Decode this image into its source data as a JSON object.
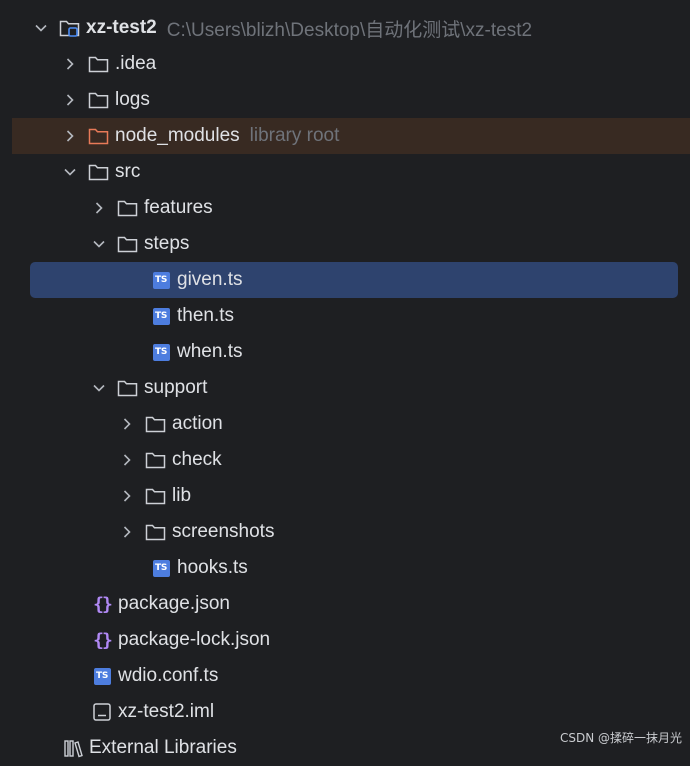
{
  "project": {
    "name": "xz-test2",
    "path": "C:\\Users\\blizh\\Desktop\\自动化测试\\xz-test2"
  },
  "tree": {
    "idea": ".idea",
    "logs": "logs",
    "node_modules": "node_modules",
    "node_modules_hint": "library root",
    "src": "src",
    "features": "features",
    "steps": "steps",
    "given": "given.ts",
    "then": "then.ts",
    "when": "when.ts",
    "support": "support",
    "action": "action",
    "check": "check",
    "lib": "lib",
    "screenshots": "screenshots",
    "hooks": "hooks.ts",
    "package_json": "package.json",
    "package_lock": "package-lock.json",
    "wdio_conf": "wdio.conf.ts",
    "iml": "xz-test2.iml",
    "external_libraries": "External Libraries"
  },
  "icons": {
    "ts_badge": "TS",
    "json_badge": "{}"
  },
  "watermark": "CSDN @揉碎一抹月光",
  "colors": {
    "background": "#1e1f22",
    "selection": "#2e436e",
    "excluded_row": "#382a22",
    "excluded_folder": "#e87a58",
    "ts_badge": "#4d7ddf",
    "json_badge": "#b189f5"
  }
}
